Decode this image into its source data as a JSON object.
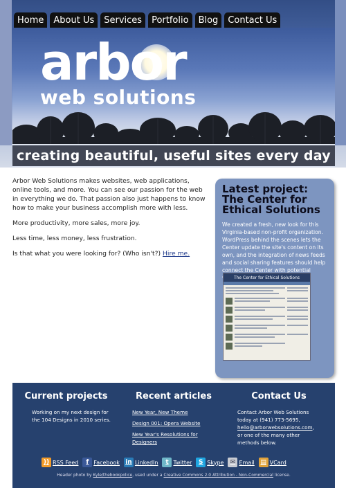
{
  "nav": {
    "items": [
      {
        "label": "Home"
      },
      {
        "label": "About Us"
      },
      {
        "label": "Services"
      },
      {
        "label": "Portfolio"
      },
      {
        "label": "Blog"
      },
      {
        "label": "Contact Us"
      }
    ]
  },
  "header": {
    "logo_main": "arbor",
    "logo_sub": "web solutions",
    "tagline": "creating beautiful, useful sites every day"
  },
  "main": {
    "p1": "Arbor Web Solutions makes websites, web applications, online tools, and more. You can see our passion for the web in everything we do. That passion also just happens to know how to make your business accomplish more with less.",
    "p2": "More productivity, more sales, more joy.",
    "p3": "Less time, less money, less frustration.",
    "p4": "Is that what you were looking for? (Who isn't?)",
    "hire_link": "Hire me."
  },
  "feature": {
    "heading_1": "Latest project:",
    "heading_2": "The Center for Ethical Solutions",
    "body": "We created a fresh, new look for this Virginia-based non-profit organization. WordPress behind the scenes lets the Center update the site's content on its own, and the integration of news feeds and social sharing features should help connect the Center with potential volunteers and donors.",
    "screenshot_title": "The Center for Ethical Solutions"
  },
  "footer": {
    "projects": {
      "heading": "Current projects",
      "text": "Working on my next design for the 104 Designs in 2010 series."
    },
    "articles": {
      "heading": "Recent articles",
      "links": [
        "New Year, New Theme",
        "Design 001: Opera Website",
        "New Year's Resolutions for Designers"
      ]
    },
    "contact": {
      "heading": "Contact Us",
      "text_1": "Contact Arbor Web Solutions today at (941) 773-5695,",
      "email": "hello@arborwebsolutions.com",
      "text_2": ", or one of the many other methods below."
    },
    "social": [
      {
        "label": "RSS Feed",
        "icon": "rss-icon",
        "color": "#f39c2a",
        "glyph": "))"
      },
      {
        "label": "Facebook",
        "icon": "facebook-icon",
        "color": "#3b5998",
        "glyph": "f"
      },
      {
        "label": "LinkedIn",
        "icon": "linkedin-icon",
        "color": "#2a7bb6",
        "glyph": "in"
      },
      {
        "label": "Twitter",
        "icon": "twitter-icon",
        "color": "#6fb7c9",
        "glyph": "t"
      },
      {
        "label": "Skype",
        "icon": "skype-icon",
        "color": "#1fa5e0",
        "glyph": "S"
      },
      {
        "label": "Email",
        "icon": "email-icon",
        "color": "#c8cbd2",
        "glyph": "✉"
      },
      {
        "label": "VCard",
        "icon": "vcard-icon",
        "color": "#e0a23a",
        "glyph": "▤"
      }
    ],
    "credit_1": "Header photo by",
    "credit_author": "Kyle/thebookpolice",
    "credit_2": ", used under a",
    "credit_license": "Creative Commons 2.0 Attribution - Non-Commercial",
    "credit_3": "license."
  }
}
